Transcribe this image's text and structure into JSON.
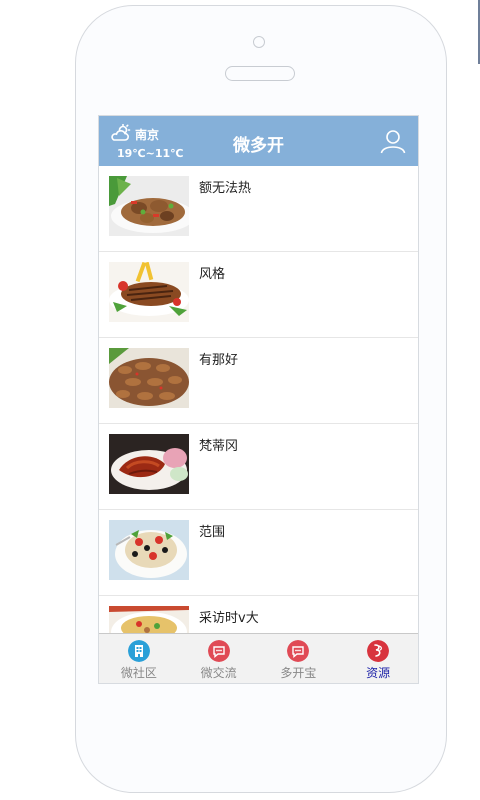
{
  "header": {
    "city": "南京",
    "temperature": "19℃~11℃",
    "title": "微多开",
    "weather_icon": "cloudy-sun-icon",
    "user_icon": "user-icon"
  },
  "list": {
    "items": [
      {
        "title": "额无法热",
        "thumb": "food-image-stirfry"
      },
      {
        "title": "风格",
        "thumb": "food-image-steak"
      },
      {
        "title": "有那好",
        "thumb": "food-image-fried"
      },
      {
        "title": "梵蒂冈",
        "thumb": "food-image-roast-duck"
      },
      {
        "title": "范围",
        "thumb": "food-image-salad"
      },
      {
        "title": "采访时v大",
        "thumb": "food-image-dish"
      }
    ]
  },
  "tabbar": {
    "tabs": [
      {
        "label": "微社区",
        "icon": "building-icon",
        "color": "#2aa0d8"
      },
      {
        "label": "微交流",
        "icon": "chat-icon",
        "color": "#e04a55"
      },
      {
        "label": "多开宝",
        "icon": "chat-icon",
        "color": "#e04a55"
      },
      {
        "label": "资源",
        "icon": "resource-icon",
        "color": "#d8343e"
      }
    ],
    "active_index": 3
  },
  "colors": {
    "header_bg": "#85b0d9",
    "active_tab": "#1d22a8",
    "inactive_tab": "#888888"
  }
}
